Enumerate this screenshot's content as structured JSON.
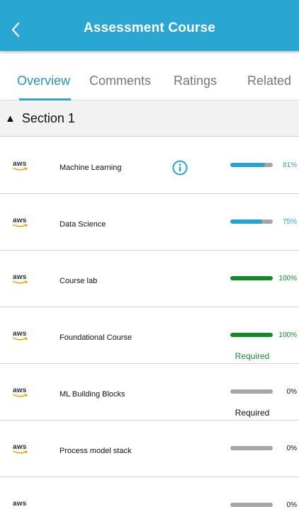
{
  "header": {
    "title": "Assessment Course",
    "back_icon": "chevron-left-icon",
    "background_color": "#2aa6d2"
  },
  "tabs": [
    {
      "label": "Overview",
      "active": true
    },
    {
      "label": "Comments",
      "active": false
    },
    {
      "label": "Ratings",
      "active": false
    },
    {
      "label": "Related",
      "active": false
    }
  ],
  "section": {
    "arrow": "▲",
    "title": "Section 1"
  },
  "courses": [
    {
      "provider": "aws",
      "name": "Machine Learning",
      "info": true,
      "progress_percent": 81,
      "progress_label": "81%",
      "status": "in-progress",
      "required": ""
    },
    {
      "provider": "aws",
      "name": "Data Science",
      "info": false,
      "progress_percent": 75,
      "progress_label": "75%",
      "status": "in-progress",
      "required": ""
    },
    {
      "provider": "aws",
      "name": "Course lab",
      "info": false,
      "progress_percent": 100,
      "progress_label": "100%",
      "status": "complete",
      "required": ""
    },
    {
      "provider": "aws",
      "name": "Foundational Course",
      "info": false,
      "progress_percent": 100,
      "progress_label": "100%",
      "status": "complete",
      "required": "Required"
    },
    {
      "provider": "aws",
      "name": "ML Building Blocks",
      "info": false,
      "progress_percent": 0,
      "progress_label": "0%",
      "status": "not-started",
      "required": "Required"
    },
    {
      "provider": "aws",
      "name": "Process model stack",
      "info": false,
      "progress_percent": 0,
      "progress_label": "0%",
      "status": "not-started",
      "required": ""
    },
    {
      "provider": "aws",
      "name": "",
      "info": false,
      "progress_percent": 0,
      "progress_label": "0%",
      "status": "not-started",
      "required": ""
    }
  ],
  "colors": {
    "in_progress": "#27a3cf",
    "complete": "#118a27",
    "required_complete": "#1b8a30",
    "required_default": "#111111",
    "track": "#a6a6a6",
    "tab_active": "#2a93c4"
  }
}
